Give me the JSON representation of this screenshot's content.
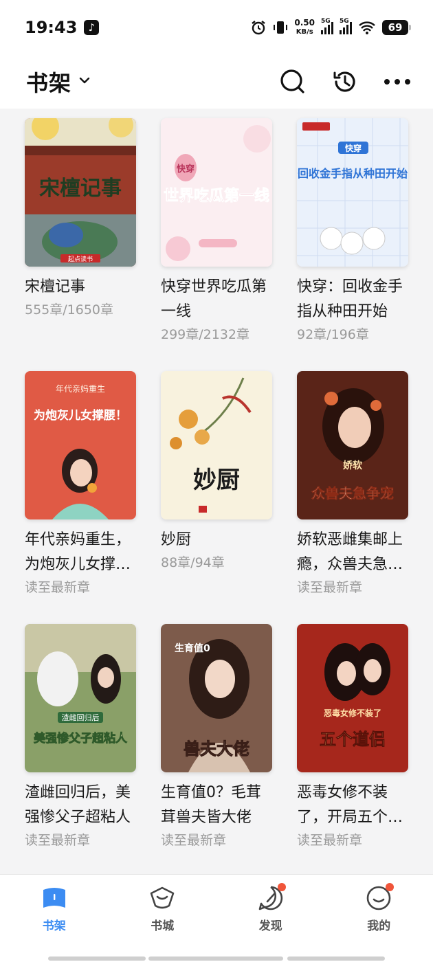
{
  "status": {
    "time": "19:43",
    "net_speed_value": "0.50",
    "net_speed_unit": "KB/s",
    "sim1": "5G",
    "sim2": "5G",
    "battery": "69"
  },
  "header": {
    "title": "书架"
  },
  "books": [
    {
      "title": "宋檀记事",
      "progress": "555章/1650章",
      "cover_text": "宋檀记事",
      "cover_tag": "起点读书"
    },
    {
      "title": "快穿世界吃瓜第一线",
      "progress": "299章/2132章",
      "cover_text": "世界吃瓜第一线",
      "cover_tag": "快穿"
    },
    {
      "title": "快穿：回收金手指从种田开始",
      "progress": "92章/196章",
      "cover_text": "回收金手指从种田开始",
      "cover_tag": "快穿"
    },
    {
      "title": "年代亲妈重生，为炮灰儿女撑腰！",
      "progress": "读至最新章",
      "cover_text": "为炮灰儿女撑腰！",
      "cover_tag": "年代亲妈重生"
    },
    {
      "title": "妙厨",
      "progress": "88章/94章",
      "cover_text": "妙厨",
      "cover_tag": ""
    },
    {
      "title": "娇软恶雌集邮上瘾，众兽夫急争宠",
      "progress": "读至最新章",
      "cover_text": "众兽夫急争宠",
      "cover_tag": "娇软"
    },
    {
      "title": "渣雌回归后，美强惨父子超粘人",
      "progress": "读至最新章",
      "cover_text": "美强惨父子超粘人",
      "cover_tag": "渣雌回归后"
    },
    {
      "title": "生育值0？毛茸茸兽夫皆大佬",
      "progress": "读至最新章",
      "cover_text": "兽夫大佬",
      "cover_tag": "生育值0"
    },
    {
      "title": "恶毒女修不装了，开局五个道侣",
      "progress": "读至最新章",
      "cover_text": "五个道侣",
      "cover_tag": "恶毒女修不装了"
    }
  ],
  "nav": [
    {
      "label": "书架",
      "icon": "bookshelf-icon",
      "active": true
    },
    {
      "label": "书城",
      "icon": "bookstore-icon",
      "active": false
    },
    {
      "label": "发现",
      "icon": "discover-icon",
      "active": false
    },
    {
      "label": "我的",
      "icon": "profile-icon",
      "active": false
    }
  ],
  "colors": {
    "accent": "#3c8cf2",
    "badge": "#f0553a"
  }
}
